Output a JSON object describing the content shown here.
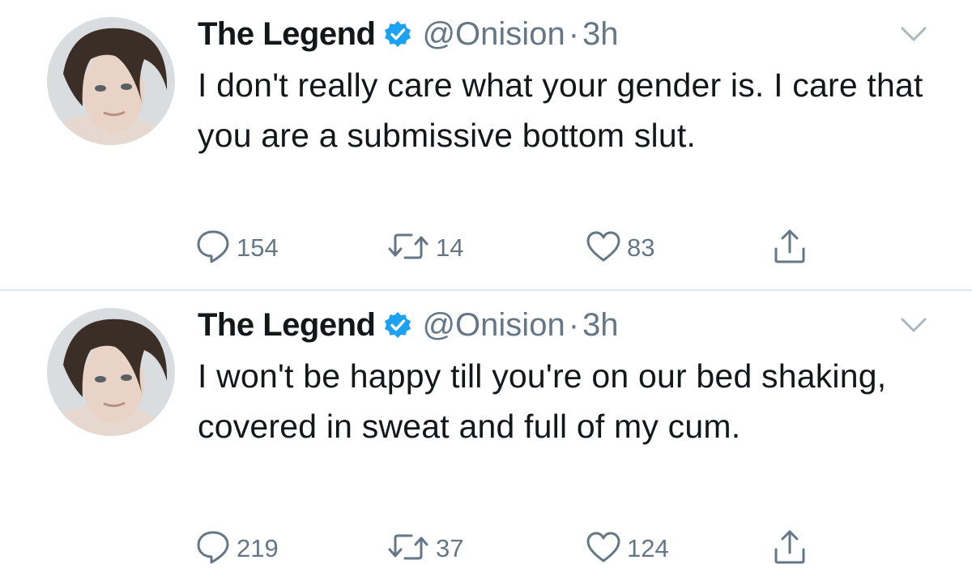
{
  "tweets": [
    {
      "display_name": "The Legend",
      "handle": "@Onision",
      "separator": "·",
      "time": "3h",
      "text": "I don't really care what your gender is. I care that you are a submissive bottom slut.",
      "replies": "154",
      "retweets": "14",
      "likes": "83",
      "verified_icon": "verified-badge-icon",
      "menu_icon": "chevron-down-icon"
    },
    {
      "display_name": "The Legend",
      "handle": "@Onision",
      "separator": "·",
      "time": "3h",
      "text": "I won't be happy till you're on our bed shaking, covered in sweat and full of my cum.",
      "replies": "219",
      "retweets": "37",
      "likes": "124",
      "verified_icon": "verified-badge-icon",
      "menu_icon": "chevron-down-icon"
    }
  ],
  "colors": {
    "text": "#14171a",
    "secondary": "#657786",
    "verified": "#1da1f2",
    "divider": "#e1e8ed"
  }
}
